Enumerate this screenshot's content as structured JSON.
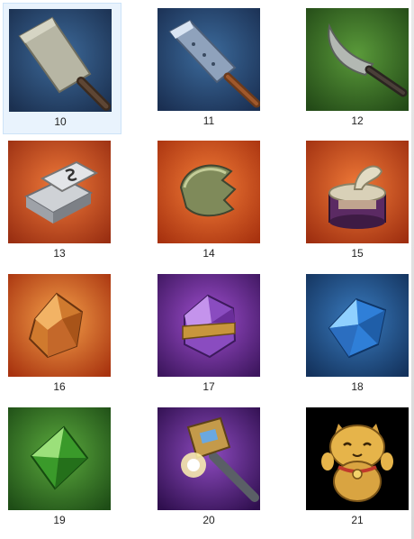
{
  "items": [
    {
      "label": "10",
      "icon": "cleaver-knife-icon",
      "bg": "#2c4a72"
    },
    {
      "label": "11",
      "icon": "broad-blade-knife-icon",
      "bg": "#2b4a73"
    },
    {
      "label": "12",
      "icon": "curved-knife-icon",
      "bg": "#3f7a2a"
    },
    {
      "label": "13",
      "icon": "silver-ingots-icon",
      "bg": "#c84b22"
    },
    {
      "label": "14",
      "icon": "jade-curved-piece-icon",
      "bg": "#cc4a20"
    },
    {
      "label": "15",
      "icon": "open-tin-can-icon",
      "bg": "#c9481f"
    },
    {
      "label": "16",
      "icon": "amber-crystal-icon",
      "bg": "#c64a22"
    },
    {
      "label": "17",
      "icon": "purple-crystal-icon",
      "bg": "#6a2f9a"
    },
    {
      "label": "18",
      "icon": "blue-crystal-icon",
      "bg": "#1f4e86"
    },
    {
      "label": "19",
      "icon": "green-gem-icon",
      "bg": "#2f7b25"
    },
    {
      "label": "20",
      "icon": "glowing-hammer-icon",
      "bg": "#5a2a8a"
    },
    {
      "label": "21",
      "icon": "lucky-cat-icon",
      "bg": "#000000"
    }
  ]
}
